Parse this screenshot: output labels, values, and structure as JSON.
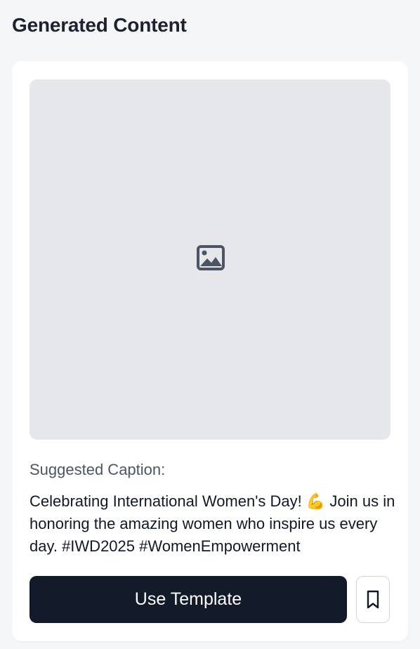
{
  "page": {
    "title": "Generated Content"
  },
  "preview": {
    "icon": "image-icon",
    "background_color": "#e5e7eb"
  },
  "caption": {
    "label": "Suggested Caption:",
    "text": "Celebrating International Women's Day! 💪 Join us in honoring the amazing women who inspire us every day. #IWD2025 #WomenEmpowerment"
  },
  "actions": {
    "use_template_label": "Use Template",
    "use_template_color": "#131a29",
    "bookmark_icon": "bookmark-icon"
  }
}
